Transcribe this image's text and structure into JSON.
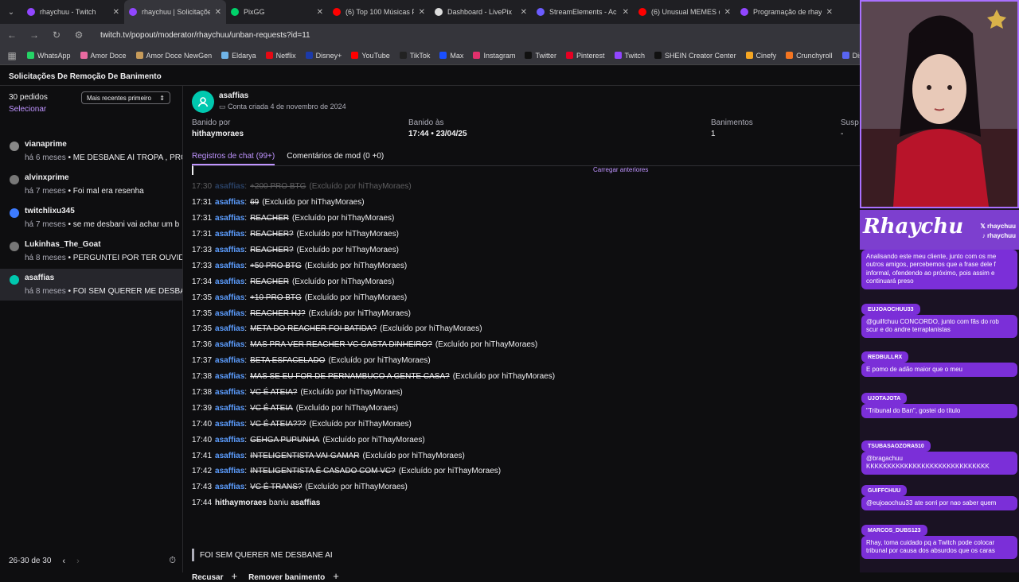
{
  "browser": {
    "tabs": [
      {
        "title": "rhaychuu - Twitch",
        "color": "#9146ff"
      },
      {
        "title": "rhaychuu | Solicitações",
        "color": "#9146ff",
        "active": true
      },
      {
        "title": "PixGG",
        "color": "#00d26a"
      },
      {
        "title": "(6) Top 100 Músicas P",
        "color": "#ff0000"
      },
      {
        "title": "Dashboard - LivePix",
        "color": "#dddddd"
      },
      {
        "title": "StreamElements - Ac",
        "color": "#6b5cff"
      },
      {
        "title": "(6) Unusual MEMES c",
        "color": "#ff0000"
      },
      {
        "title": "Programação de rhay",
        "color": "#9146ff"
      }
    ],
    "url": "twitch.tv/popout/moderator/rhaychuu/unban-requests?id=11",
    "bookmarks": [
      {
        "label": "WhatsApp",
        "color": "#25d366"
      },
      {
        "label": "Amor Doce",
        "color": "#e86aa0"
      },
      {
        "label": "Amor Doce NewGen",
        "color": "#c79b5a"
      },
      {
        "label": "Eldarya",
        "color": "#6fb4e8"
      },
      {
        "label": "Netflix",
        "color": "#e50914"
      },
      {
        "label": "Disney+",
        "color": "#1c3aa9"
      },
      {
        "label": "YouTube",
        "color": "#ff0000"
      },
      {
        "label": "TikTok",
        "color": "#222222"
      },
      {
        "label": "Max",
        "color": "#1a4fff"
      },
      {
        "label": "Instagram",
        "color": "#e1306c"
      },
      {
        "label": "Twitter",
        "color": "#111111"
      },
      {
        "label": "Pinterest",
        "color": "#e60023"
      },
      {
        "label": "Twitch",
        "color": "#9146ff"
      },
      {
        "label": "SHEIN Creator Center",
        "color": "#111111"
      },
      {
        "label": "Cinefy",
        "color": "#f5a623"
      },
      {
        "label": "Crunchyroll",
        "color": "#f47521"
      },
      {
        "label": "Disco",
        "color": "#5865f2"
      }
    ]
  },
  "page": {
    "title": "Solicitações De Remoção De Banimento"
  },
  "sidebar": {
    "count": "30 pedidos",
    "select": "Selecionar",
    "sort": "Mais recentes primeiro",
    "requests": [
      {
        "name": "vianaprime",
        "ago": "há 6 meses",
        "text": "ME DESBANE AÍ TROPA , PRO",
        "color": "#888888"
      },
      {
        "name": "alvinxprime",
        "ago": "há 7 meses",
        "text": "Foi mal era resenha",
        "color": "#777777"
      },
      {
        "name": "twitchlixu345",
        "ago": "há 7 meses",
        "text": "se me desbani vai achar um b",
        "color": "#3d7bff"
      },
      {
        "name": "Lukinhas_The_Goat",
        "ago": "há 8 meses",
        "text": "PERGUNTEI POR TER OUVIDO",
        "color": "#777777"
      },
      {
        "name": "asaffias",
        "ago": "há 8 meses",
        "text": "FOI SEM QUERER ME DESBANE",
        "color": "#00c8af",
        "selected": true
      }
    ],
    "pager": "26-30 de 30"
  },
  "detail": {
    "user": "asaffias",
    "created": "Conta criada 4 de novembro de 2024",
    "banned_by_label": "Banido por",
    "banned_by": "hithaymoraes",
    "banned_at_label": "Banido às",
    "banned_at": "17:44 • 23/04/25",
    "bans_label": "Banimentos",
    "bans": "1",
    "susp_label": "Susp",
    "susp": "-",
    "tab_chat": "Registros de chat (99+)",
    "tab_mod": "Comentários de mod (0 +0)",
    "load_more": "Carregar anteriores",
    "chat": [
      {
        "time": "17:30",
        "user": "asaffias",
        "msg": "+200 PRO BTG",
        "note": "(Excluído por hiThayMoraes)",
        "fade": true
      },
      {
        "time": "17:31",
        "user": "asaffias",
        "msg": "69",
        "note": "(Excluído por hiThayMoraes)"
      },
      {
        "time": "17:31",
        "user": "asaffias",
        "msg": "REACHER",
        "note": "(Excluído por hiThayMoraes)"
      },
      {
        "time": "17:31",
        "user": "asaffias",
        "msg": "REACHER?",
        "note": "(Excluído por hiThayMoraes)"
      },
      {
        "time": "17:33",
        "user": "asaffias",
        "msg": "REACHER?",
        "note": "(Excluído por hiThayMoraes)"
      },
      {
        "time": "17:33",
        "user": "asaffias",
        "msg": "+50 PRO BTG",
        "note": "(Excluído por hiThayMoraes)"
      },
      {
        "time": "17:34",
        "user": "asaffias",
        "msg": "REACHER",
        "note": "(Excluído por hiThayMoraes)"
      },
      {
        "time": "17:35",
        "user": "asaffias",
        "msg": "+10 PRO BTG",
        "note": "(Excluído por hiThayMoraes)"
      },
      {
        "time": "17:35",
        "user": "asaffias",
        "msg": "REACHER HJ?",
        "note": "(Excluído por hiThayMoraes)"
      },
      {
        "time": "17:35",
        "user": "asaffias",
        "msg": "META DO REACHER FOI BATIDA?",
        "note": "(Excluído por hiThayMoraes)"
      },
      {
        "time": "17:36",
        "user": "asaffias",
        "msg": "MAS PRA VER REACHER VC GASTA DINHEIRO?",
        "note": "(Excluído por hiThayMoraes)"
      },
      {
        "time": "17:37",
        "user": "asaffias",
        "msg": "BETA ESFACELADO",
        "note": "(Excluído por hiThayMoraes)"
      },
      {
        "time": "17:38",
        "user": "asaffias",
        "msg": "MAS SE EU FOR DE PERNAMBUCO A GENTE CASA?",
        "note": "(Excluído por hiThayMoraes)"
      },
      {
        "time": "17:38",
        "user": "asaffias",
        "msg": "VC É ATEIA?",
        "note": "(Excluído por hiThayMoraes)"
      },
      {
        "time": "17:39",
        "user": "asaffias",
        "msg": "VC É ATEIA",
        "note": "(Excluído por hiThayMoraes)"
      },
      {
        "time": "17:40",
        "user": "asaffias",
        "msg": "VC É ATEIA???",
        "note": "(Excluído por hiThayMoraes)"
      },
      {
        "time": "17:40",
        "user": "asaffias",
        "msg": "GEHGA PUPUNHA",
        "note": "(Excluído por hiThayMoraes)"
      },
      {
        "time": "17:41",
        "user": "asaffias",
        "msg": "INTELIGENTISTA VAI GAMAR",
        "note": "(Excluído por hiThayMoraes)"
      },
      {
        "time": "17:42",
        "user": "asaffias",
        "msg": "INTELIGENTISTA É CASADO COM VC?",
        "note": "(Excluído por hiThayMoraes)"
      },
      {
        "time": "17:43",
        "user": "asaffias",
        "msg": "VC É TRANS?",
        "note": "(Excluído por hiThayMoraes)"
      }
    ],
    "ban_line": {
      "time": "17:44",
      "mod": "hithaymoraes",
      "verb": "baniu",
      "target": "asaffias"
    },
    "appeal": "FOI SEM QUERER ME DESBANE AI",
    "reject": "Recusar",
    "unban": "Remover banimento"
  },
  "overlay": {
    "logo": "Rhaychu",
    "social1": "rhaychuu",
    "social2": "rhaychuu",
    "msgs": [
      {
        "user": "",
        "text": "Analisando este meu cliente, junto com os me outros amigos, percebemos que a frase dele f informal, ofendendo ao próximo, pois assim e continuará preso"
      },
      {
        "user": "EUJOAOCHUU33",
        "text": "@guilfchuu CONCORDO, junto com fãs do rob scur e do andre terraplanistas"
      },
      {
        "user": "REDBULLRX",
        "text": "E pomo de adão maior que o meu"
      },
      {
        "user": "UJOTAJOTA",
        "text": "\"Tribunal do Ban\", gostei do título"
      },
      {
        "user": "TSUBASAOZORA510",
        "text": "@bragachuu KKKKKKKKKKKKKKKKKKKKKKKKKKKKK"
      },
      {
        "user": "GUIFFCHUU",
        "text": "@eujoaochuu33 ate sorri por nao saber quem"
      },
      {
        "user": "MARCOS_DUBS123",
        "text": "Rhay, toma cuidado pq a Twitch pode colocar tribunal por causa dos absurdos que os caras"
      }
    ]
  }
}
